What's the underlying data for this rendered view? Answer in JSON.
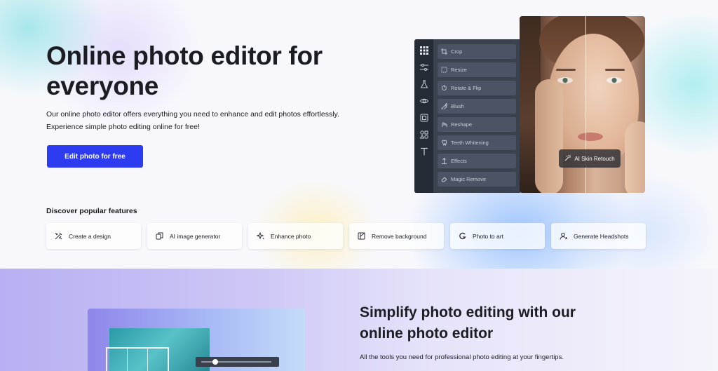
{
  "hero": {
    "title": "Online photo editor for everyone",
    "description_line1": "Our online photo editor offers everything you need to enhance and edit photos effortlessly.",
    "description_line2": "Experience simple photo editing online for free!",
    "cta_label": "Edit photo for free"
  },
  "editor": {
    "rail_icons": [
      "grid-icon",
      "sliders-icon",
      "flask-icon",
      "eye-icon",
      "frame-icon",
      "shapes-icon",
      "text-icon"
    ],
    "tools": [
      {
        "label": "Crop",
        "icon": "crop-icon"
      },
      {
        "label": "Resize",
        "icon": "resize-icon"
      },
      {
        "label": "Rotate & Flip",
        "icon": "rotate-icon"
      },
      {
        "label": "Blush",
        "icon": "blush-icon"
      },
      {
        "label": "Reshape",
        "icon": "reshape-icon"
      },
      {
        "label": "Teeth Whitening",
        "icon": "teeth-icon"
      },
      {
        "label": "Effects",
        "icon": "effects-icon"
      },
      {
        "label": "Magic Remove",
        "icon": "eraser-icon"
      }
    ],
    "badge_label": "AI Skin Retouch"
  },
  "features": {
    "title": "Discover popular features",
    "items": [
      {
        "label": "Create a design",
        "icon": "design-icon"
      },
      {
        "label": "AI image generator",
        "icon": "ai-image-icon"
      },
      {
        "label": "Enhance photo",
        "icon": "sparkle-icon"
      },
      {
        "label": "Remove background",
        "icon": "remove-bg-icon"
      },
      {
        "label": "Photo to art",
        "icon": "art-icon"
      },
      {
        "label": "Generate Headshots",
        "icon": "headshot-icon"
      }
    ]
  },
  "section2": {
    "title": "Simplify photo editing with our online photo editor",
    "description": "All the tools you need for professional photo editing at your fingertips."
  },
  "colors": {
    "accent": "#2d3cf0",
    "text": "#1b1d22",
    "editor_panel": "#3a4250"
  }
}
